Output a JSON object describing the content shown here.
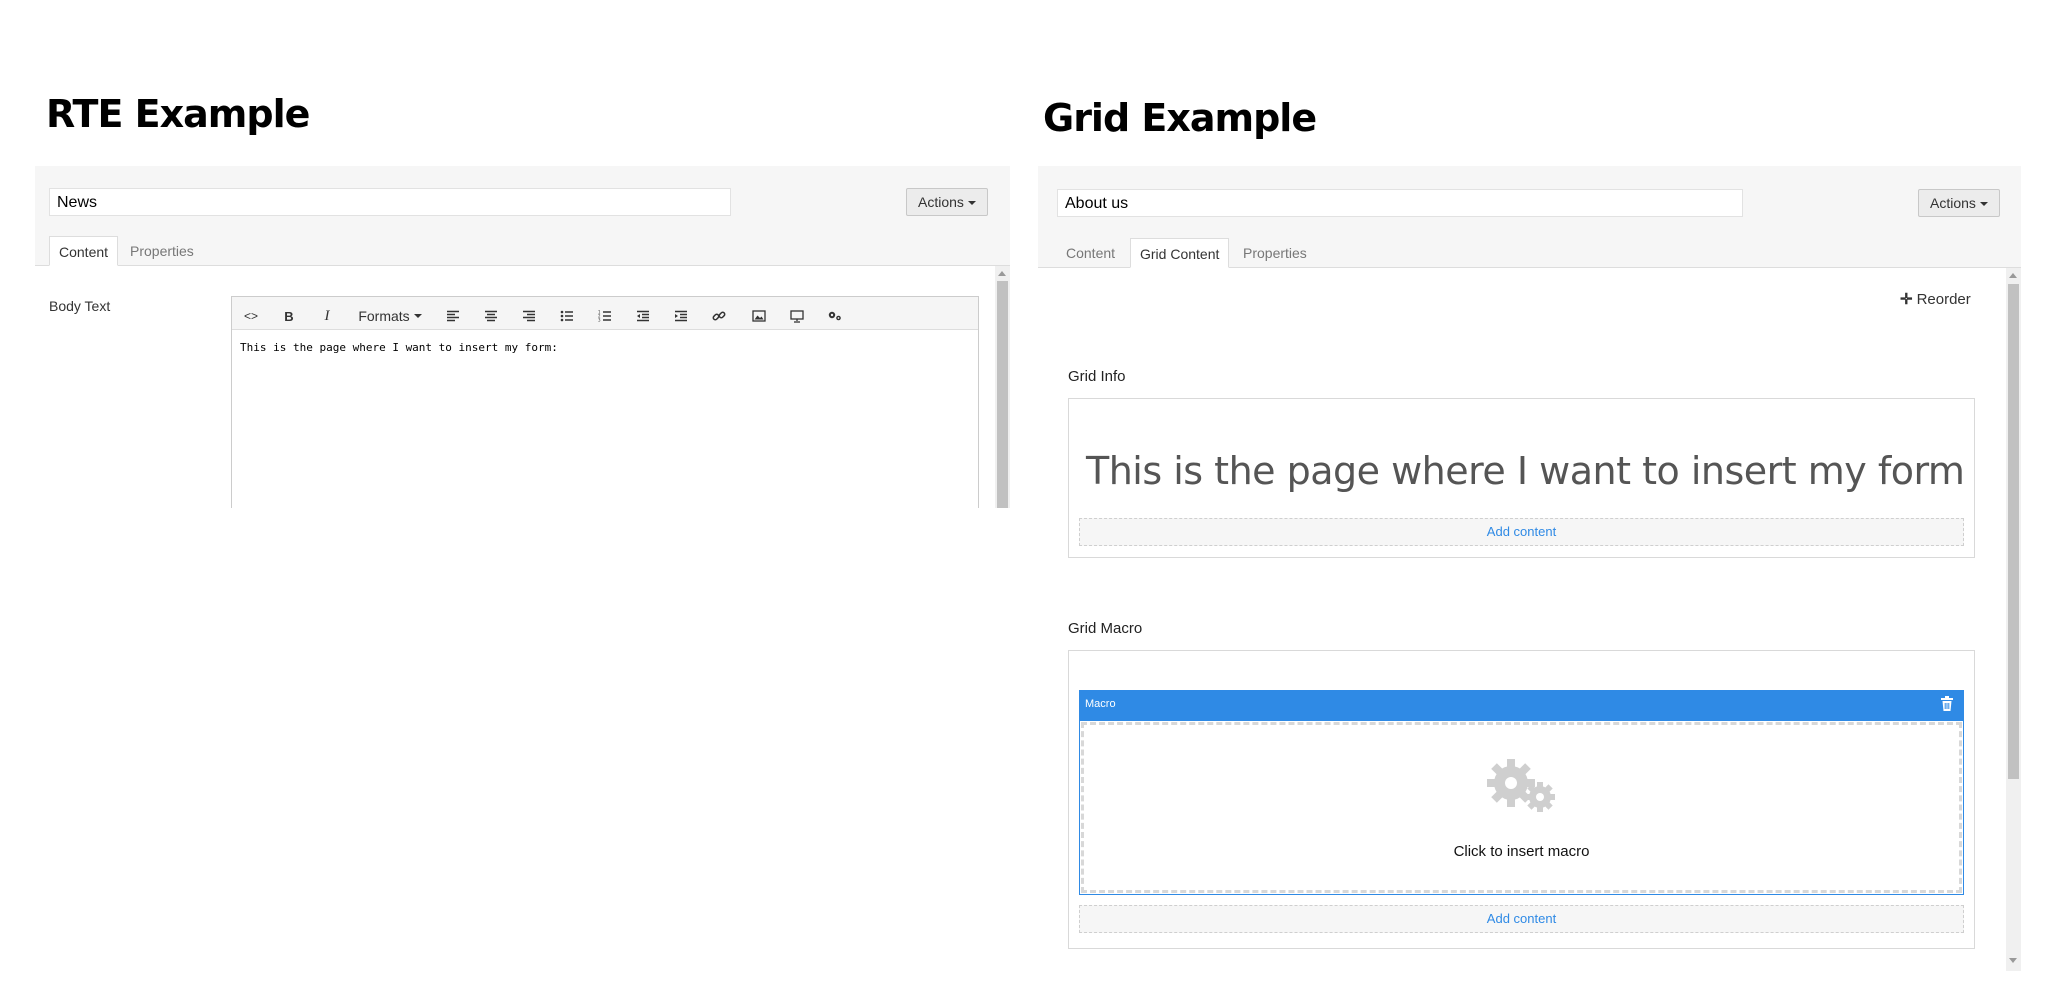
{
  "rte": {
    "heading": "RTE Example",
    "name_value": "News",
    "actions_label": "Actions",
    "tabs": [
      {
        "label": "Content"
      },
      {
        "label": "Properties"
      }
    ],
    "property_label": "Body Text",
    "toolbar": {
      "formats_label": "Formats",
      "buttons": [
        "source-code",
        "bold",
        "italic",
        "formats",
        "align-left",
        "align-center",
        "align-right",
        "bullet-list",
        "numbered-list",
        "outdent",
        "indent",
        "link",
        "image",
        "embed",
        "macro"
      ]
    },
    "body_text": "This is the page where I want to insert my form:"
  },
  "grid": {
    "heading": "Grid Example",
    "name_value": "About us",
    "actions_label": "Actions",
    "tabs": [
      {
        "label": "Content"
      },
      {
        "label": "Grid Content"
      },
      {
        "label": "Properties"
      }
    ],
    "reorder_label": "Reorder",
    "info": {
      "label": "Grid Info",
      "text": "This is the page where I want to insert my form",
      "add_content": "Add content"
    },
    "macro": {
      "label": "Grid Macro",
      "bar_label": "Macro",
      "placeholder": "Click to insert macro",
      "add_content": "Add content"
    }
  },
  "colors": {
    "accent": "#2f8ae5",
    "panel": "#f6f6f6",
    "link": "#2f8ae5"
  }
}
